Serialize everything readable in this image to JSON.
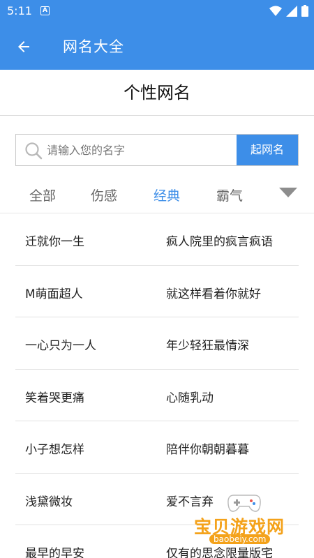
{
  "status_bar": {
    "time": "5:11",
    "notif_letter": "A"
  },
  "app_bar": {
    "title": "网名大全"
  },
  "page_title": "个性网名",
  "search": {
    "placeholder": "请输入您的名字",
    "button_label": "起网名"
  },
  "tabs": [
    {
      "label": "全部",
      "active": false
    },
    {
      "label": "伤感",
      "active": false
    },
    {
      "label": "经典",
      "active": true
    },
    {
      "label": "霸气",
      "active": false
    }
  ],
  "names": [
    {
      "left": "迁就你一生",
      "right": "疯人院里的疯言疯语"
    },
    {
      "left": "M萌面超人",
      "right": "就这样看着你就好"
    },
    {
      "left": "一心只为一人",
      "right": "年少轻狂最情深"
    },
    {
      "left": "笑着哭更痛",
      "right": "心随乳动"
    },
    {
      "left": "小子想怎样",
      "right": "陪伴你朝朝暮暮"
    },
    {
      "left": "浅黛微妆",
      "right": "爱不言弃"
    },
    {
      "left": "最早的早安",
      "right": "仅有的思念限量版宅"
    }
  ],
  "watermark": {
    "text": "宝贝游戏网",
    "url": "baobeiy.com"
  },
  "colors": {
    "primary": "#3d8ee8",
    "watermark": "#f4a21a"
  }
}
